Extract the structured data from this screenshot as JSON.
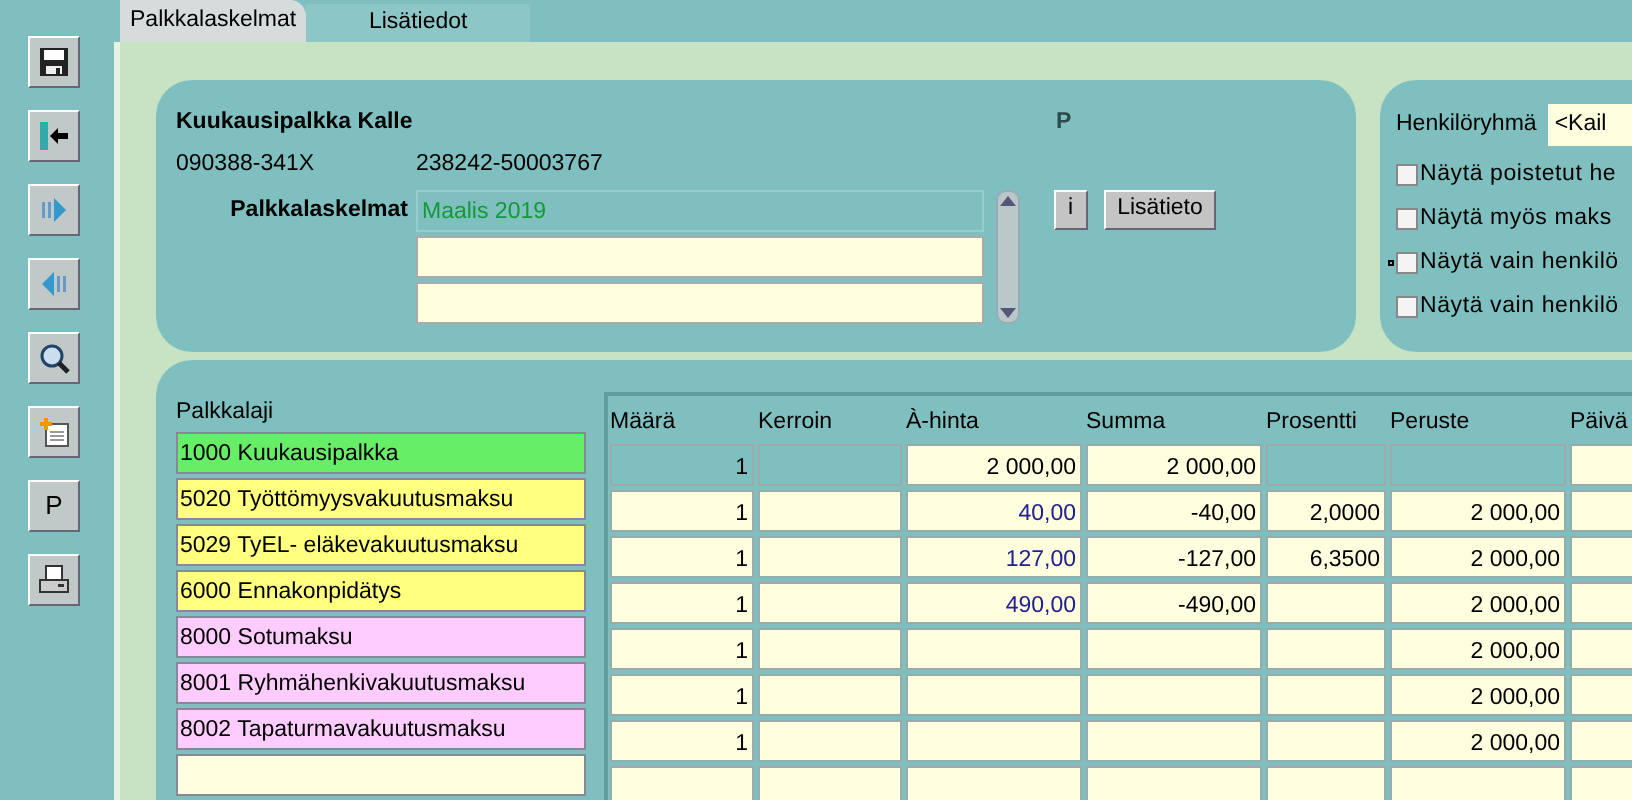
{
  "toolbar": [
    {
      "kind": "save"
    },
    {
      "kind": "exit"
    },
    {
      "kind": "next"
    },
    {
      "kind": "previous"
    },
    {
      "kind": "search"
    },
    {
      "kind": "new"
    },
    {
      "kind": "text",
      "label": "P"
    },
    {
      "kind": "print"
    }
  ],
  "tabs": [
    {
      "label": "Palkkalaskelmat",
      "selected": true
    },
    {
      "label": "Lisätiedot",
      "selected": false
    }
  ],
  "employee": {
    "name": "Kuukausipalkka Kalle",
    "id": "090388-341X",
    "account": "238242-50003767",
    "flag": "P"
  },
  "payslips": {
    "label": "Palkkalaskelmat",
    "items": [
      {
        "text": "Maalis 2019",
        "selected": true
      },
      {
        "selected": false
      },
      {
        "selected": false
      }
    ],
    "buttons": [
      "i",
      "Lisätieto"
    ]
  },
  "filters": {
    "group_label": "Henkilöryhmä",
    "group_value": "<Kail",
    "options": [
      {
        "label": "Näytä poistetut he",
        "checked": false,
        "focused": false
      },
      {
        "label": "Näytä myös maks",
        "checked": false,
        "focused": false
      },
      {
        "label": "Näytä vain henkilö",
        "checked": false,
        "focused": true
      },
      {
        "label": "Näytä vain henkilö",
        "checked": false,
        "focused": false
      }
    ]
  },
  "wage_types": {
    "label": "Palkkalaji",
    "items": [
      {
        "text": "1000 Kuukausipalkka",
        "color": "#66ee66"
      },
      {
        "text": "5020 Työttömyysvakuutusmaksu",
        "color": "#ffff80"
      },
      {
        "text": "5029 TyEL- eläkevakuutusmaksu",
        "color": "#ffff80"
      },
      {
        "text": "6000 Ennakonpidätys",
        "color": "#ffff80"
      },
      {
        "text": "8000 Sotumaksu",
        "color": "#ffccff"
      },
      {
        "text": "8001 Ryhmähenkivakuutusmaksu",
        "color": "#ffccff"
      },
      {
        "text": "8002 Tapaturmavakuutusmaksu",
        "color": "#ffccff"
      },
      {
        "color": "#ffffe0"
      }
    ]
  },
  "table": {
    "columns": [
      "Määrä",
      "Kerroin",
      "À-hinta",
      "Summa",
      "Prosentti",
      "Peruste",
      "Päivä"
    ],
    "rows": [
      [
        {
          "text": "1",
          "disabled": true
        },
        {
          "disabled": true
        },
        {
          "text": "2 000,00",
          "disabled": false,
          "highlighted": false
        },
        {
          "text": "2 000,00",
          "disabled": false
        },
        {
          "disabled": true
        },
        {
          "disabled": true
        },
        {
          "disabled": false
        }
      ],
      [
        {
          "text": "1",
          "disabled": false
        },
        {
          "disabled": false
        },
        {
          "text": "40,00",
          "disabled": false,
          "highlighted": true
        },
        {
          "text": "-40,00",
          "disabled": false
        },
        {
          "text": "2,0000",
          "disabled": false
        },
        {
          "text": "2 000,00",
          "disabled": false
        },
        {
          "disabled": false
        }
      ],
      [
        {
          "text": "1",
          "disabled": false
        },
        {
          "disabled": false
        },
        {
          "text": "127,00",
          "disabled": false,
          "highlighted": true
        },
        {
          "text": "-127,00",
          "disabled": false
        },
        {
          "text": "6,3500",
          "disabled": false
        },
        {
          "text": "2 000,00",
          "disabled": false
        },
        {
          "disabled": false
        }
      ],
      [
        {
          "text": "1",
          "disabled": false
        },
        {
          "disabled": false
        },
        {
          "text": "490,00",
          "disabled": false,
          "highlighted": true
        },
        {
          "text": "-490,00",
          "disabled": false
        },
        {
          "disabled": false
        },
        {
          "text": "2 000,00",
          "disabled": false
        },
        {
          "disabled": false
        }
      ],
      [
        {
          "text": "1",
          "disabled": false
        },
        {
          "disabled": false
        },
        {
          "disabled": false
        },
        {
          "disabled": false
        },
        {
          "disabled": false
        },
        {
          "text": "2 000,00",
          "disabled": false
        },
        {
          "disabled": false
        }
      ],
      [
        {
          "text": "1",
          "disabled": false
        },
        {
          "disabled": false
        },
        {
          "disabled": false
        },
        {
          "disabled": false
        },
        {
          "disabled": false
        },
        {
          "text": "2 000,00",
          "disabled": false
        },
        {
          "disabled": false
        }
      ],
      [
        {
          "text": "1",
          "disabled": false
        },
        {
          "disabled": false
        },
        {
          "disabled": false
        },
        {
          "disabled": false
        },
        {
          "disabled": false
        },
        {
          "text": "2 000,00",
          "disabled": false
        },
        {
          "disabled": false
        }
      ],
      [
        {
          "disabled": false
        },
        {
          "disabled": false
        },
        {
          "disabled": false
        },
        {
          "disabled": false
        },
        {
          "disabled": false
        },
        {
          "disabled": false
        },
        {
          "disabled": false
        }
      ]
    ]
  }
}
